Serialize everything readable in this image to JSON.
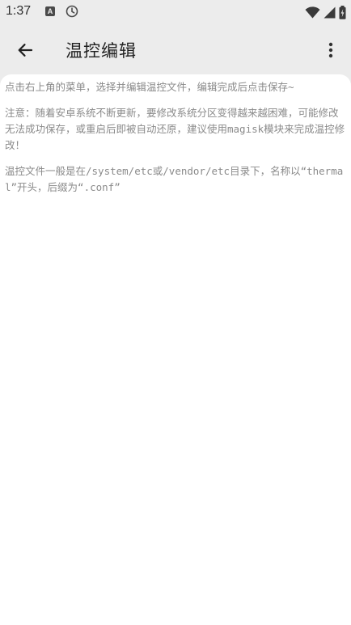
{
  "status_bar": {
    "time": "1:37",
    "notification_icon_letter": "A",
    "icons": [
      "a-notification-icon",
      "clock-icon",
      "wifi-icon",
      "cell-signal-icon",
      "battery-icon"
    ]
  },
  "app_bar": {
    "title": "温控编辑",
    "back_icon": "arrow-left-icon",
    "more_icon": "more-vertical-icon"
  },
  "content": {
    "paragraphs": [
      "点击右上角的菜单，选择并编辑温控文件，编辑完成后点击保存~",
      "注意：随着安卓系统不断更新，要修改系统分区变得越来越困难，可能修改无法成功保存，或重启后即被自动还原，建议使用magisk模块来完成温控修改！",
      "温控文件一般是在/system/etc或/vendor/etc目录下，名称以“thermal”开头，后缀为“.conf”"
    ]
  },
  "colors": {
    "bar_background": "#ececec",
    "card_background": "#ffffff",
    "title_text": "#202020",
    "body_text": "#8a8a8a"
  }
}
